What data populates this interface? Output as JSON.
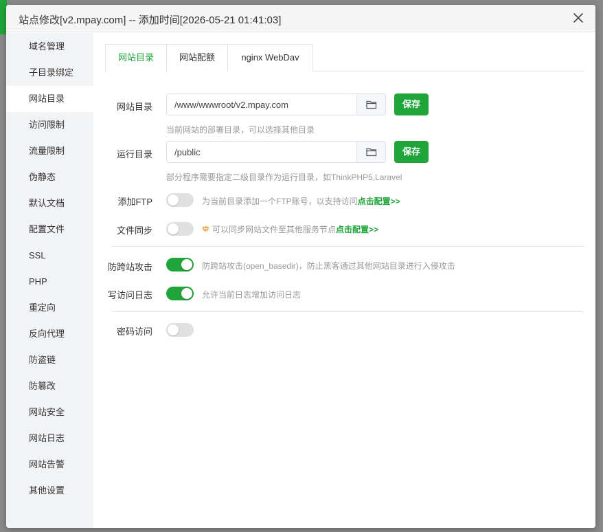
{
  "dialog": {
    "title": "站点修改[v2.mpay.com] -- 添加时间[2026-05-21 01:41:03]"
  },
  "sidebar": {
    "items": [
      {
        "label": "域名管理"
      },
      {
        "label": "子目录绑定"
      },
      {
        "label": "网站目录",
        "active": true
      },
      {
        "label": "访问限制"
      },
      {
        "label": "流量限制"
      },
      {
        "label": "伪静态"
      },
      {
        "label": "默认文档"
      },
      {
        "label": "配置文件"
      },
      {
        "label": "SSL"
      },
      {
        "label": "PHP"
      },
      {
        "label": "重定向"
      },
      {
        "label": "反向代理"
      },
      {
        "label": "防盗链"
      },
      {
        "label": "防篡改"
      },
      {
        "label": "网站安全"
      },
      {
        "label": "网站日志"
      },
      {
        "label": "网站告警"
      },
      {
        "label": "其他设置"
      }
    ]
  },
  "tabs": [
    {
      "label": "网站目录",
      "active": true
    },
    {
      "label": "网站配额"
    },
    {
      "label": "nginx WebDav"
    }
  ],
  "form": {
    "site_dir": {
      "label": "网站目录",
      "value": "/www/wwwroot/v2.mpay.com",
      "save_label": "保存",
      "hint": "当前网站的部署目录，可以选择其他目录"
    },
    "run_dir": {
      "label": "运行目录",
      "value": "/public",
      "save_label": "保存",
      "hint": "部分程序需要指定二级目录作为运行目录，如ThinkPHP5,Laravel"
    },
    "ftp": {
      "label": "添加FTP",
      "enabled": false,
      "desc": "为当前目录添加一个FTP账号，以支持访问",
      "link": "点击配置>>"
    },
    "sync": {
      "label": "文件同步",
      "enabled": false,
      "desc": "可以同步网站文件至其他服务节点",
      "link": "点击配置>>"
    },
    "cross_site": {
      "label": "防跨站攻击",
      "enabled": true,
      "desc": "防跨站攻击(open_basedir)，防止黑客通过其他网站目录进行入侵攻击"
    },
    "access_log": {
      "label": "写访问日志",
      "enabled": true,
      "desc": "允许当前日志增加访问日志"
    },
    "password": {
      "label": "密码访问",
      "enabled": false
    }
  },
  "colors": {
    "accent": "#20a53a",
    "sidebar_bg": "#f2f3f5",
    "gem": "#e6a23c"
  },
  "icons": {
    "close": "close-icon",
    "folder": "folder-icon",
    "gem": "gem-icon"
  }
}
